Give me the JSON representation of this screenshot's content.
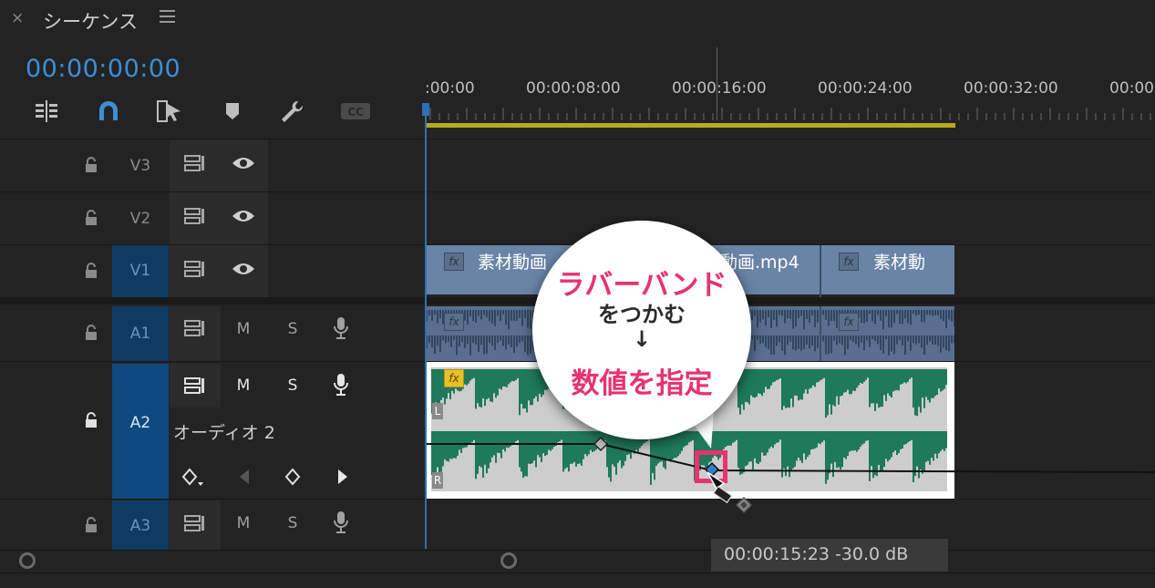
{
  "panel": {
    "close_glyph": "×",
    "title": "シーケンス",
    "menu_icon": "hamburger-icon"
  },
  "timecode": "00:00:00:00",
  "toolbar": {
    "icons": [
      "insert-edit-icon",
      "magnet-icon",
      "linked-selection-icon",
      "marker-icon",
      "wrench-icon",
      "captions-icon"
    ],
    "captions_label": "CC"
  },
  "ruler": {
    "labels": [
      ":00:00",
      "00:00:08:00",
      "00:00:16:00",
      "00:00:24:00",
      "00:00:32:00",
      "00:00"
    ]
  },
  "tracks": {
    "v3": {
      "name": "V3"
    },
    "v2": {
      "name": "V2"
    },
    "v1": {
      "name": "V1"
    },
    "a1": {
      "name": "A1",
      "mute": "M",
      "solo": "S"
    },
    "a2": {
      "name": "A2",
      "mute": "M",
      "solo": "S",
      "label": "オーディオ 2"
    },
    "a3": {
      "name": "A3",
      "mute": "M",
      "solo": "S"
    }
  },
  "clips": {
    "v1_clip1": "素材動画",
    "v1_clip2": "動画.mp4",
    "v1_clip3": "素材動",
    "fx_label": "fx",
    "channel_left": "L",
    "channel_right": "R"
  },
  "callout": {
    "line1": "ラバーバンド",
    "line2": "をつかむ",
    "arrow": "↓",
    "line3": "数値を指定"
  },
  "status": {
    "text": "00:00:15:23  -30.0 dB"
  },
  "colors": {
    "accent_blue": "#3c8fd6",
    "highlight_pink": "#e8336d",
    "clip_green": "#1e7a5a",
    "work_area": "#b8ac1e"
  }
}
